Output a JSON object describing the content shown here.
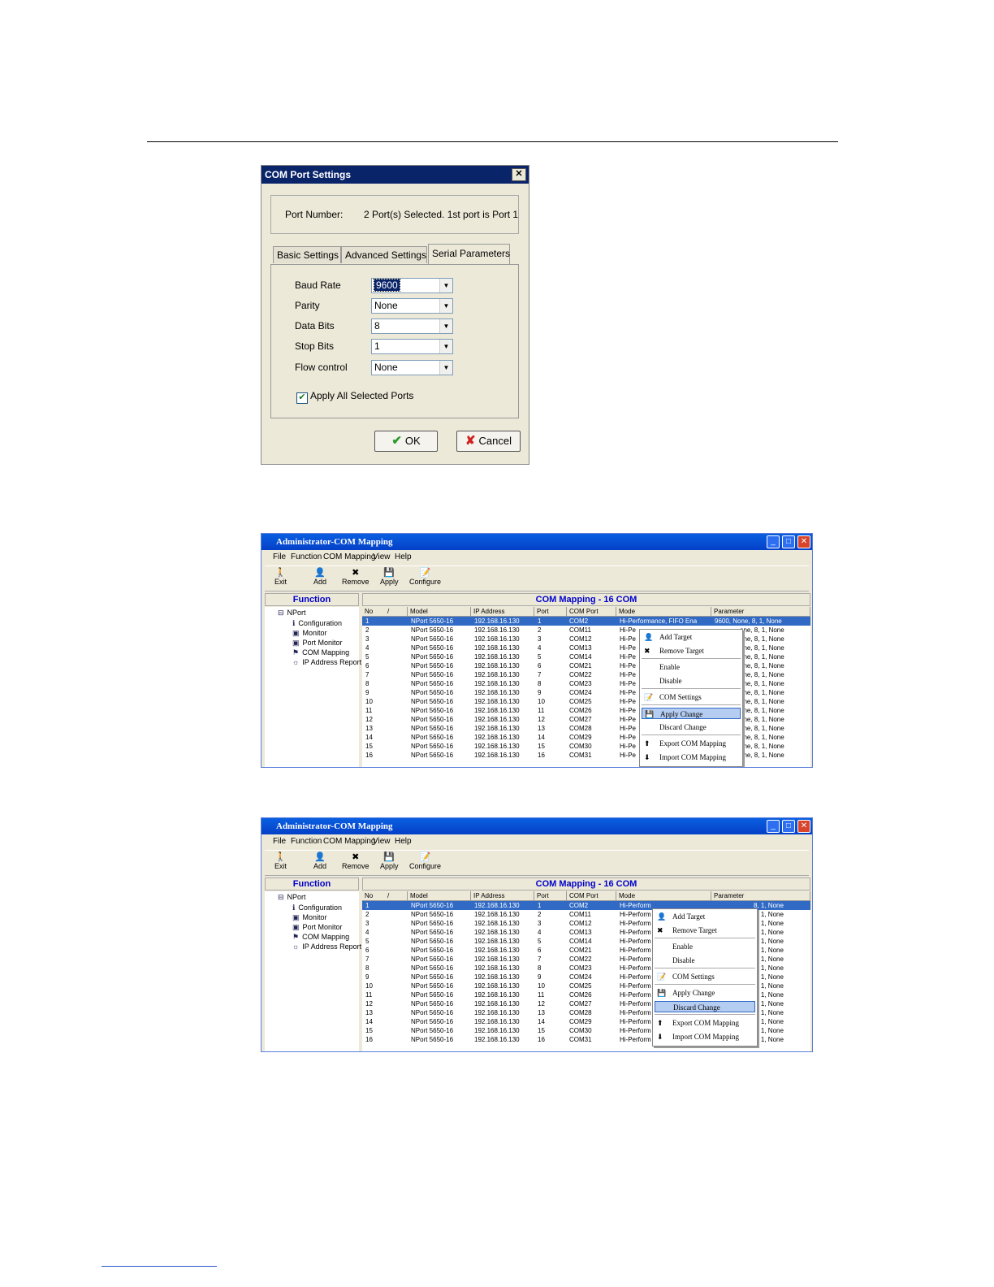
{
  "dialog": {
    "title": "COM Port Settings",
    "close_glyph": "✕",
    "port_number_label": "Port Number:",
    "port_number_value": "2 Port(s) Selected. 1st port is Port 1",
    "tabs": [
      "Basic Settings",
      "Advanced Settings",
      "Serial Parameters"
    ],
    "active_tab": "Serial Parameters",
    "fields": [
      {
        "label": "Baud Rate",
        "value": "9600"
      },
      {
        "label": "Parity",
        "value": "None"
      },
      {
        "label": "Data Bits",
        "value": "8"
      },
      {
        "label": "Stop Bits",
        "value": "1"
      },
      {
        "label": "Flow control",
        "value": "None"
      }
    ],
    "apply_all_label": "Apply All Selected Ports",
    "apply_all_checked": true,
    "ok_label": "OK",
    "cancel_label": "Cancel"
  },
  "window": {
    "title": "Administrator-COM Mapping",
    "menu": [
      "File",
      "Function",
      "COM Mapping",
      "View",
      "Help"
    ],
    "toolbar": [
      "Exit",
      "Add",
      "Remove",
      "Apply",
      "Configure"
    ],
    "function_header": "Function",
    "tree": [
      "NPort",
      "Configuration",
      "Monitor",
      "Port Monitor",
      "COM Mapping",
      "IP Address Report"
    ],
    "mapping_header": "COM Mapping - 16 COM",
    "columns": [
      "No",
      "/",
      "Model",
      "IP Address",
      "Port",
      "COM Port",
      "Mode",
      "Parameter"
    ],
    "model": "NPort 5650-16",
    "ip": "192.168.16.130",
    "com_ports": [
      "COM2",
      "COM11",
      "COM12",
      "COM13",
      "COM14",
      "COM21",
      "COM22",
      "COM23",
      "COM24",
      "COM25",
      "COM26",
      "COM27",
      "COM28",
      "COM29",
      "COM30",
      "COM31"
    ],
    "mode_text": "Hi-Performance, FIFO Ena",
    "mode_short_1": "Hi-Pe",
    "mode_short_2": "Hi-Perform",
    "param_full": "9600, None, 8, 1, None",
    "param_short_1": "one, 8, 1, None",
    "param_short_2": "8, 1, None",
    "context_menu": [
      "Add Target",
      "Remove Target",
      "Enable",
      "Disable",
      "COM Settings",
      "Apply Change",
      "Discard Change",
      "Export COM Mapping",
      "Import COM Mapping"
    ]
  },
  "screens": [
    {
      "highlighted_menu_item": "Apply Change"
    },
    {
      "highlighted_menu_item": "Discard Change"
    }
  ]
}
